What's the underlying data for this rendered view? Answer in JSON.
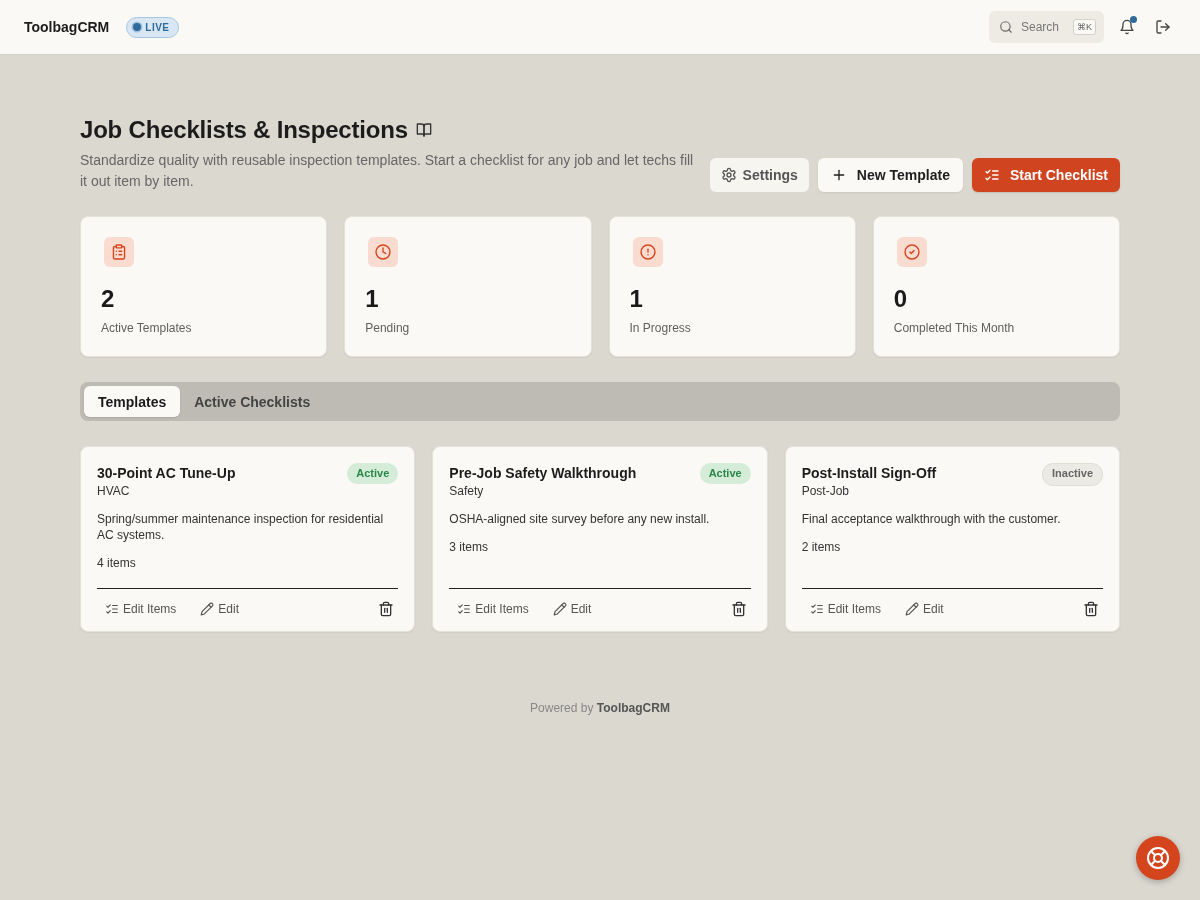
{
  "header": {
    "brand": "ToolbagCRM",
    "badge": "LIVE",
    "search": {
      "label": "Search",
      "shortcut": "⌘K"
    },
    "notifications": {
      "unread": true
    }
  },
  "page": {
    "title": "Job Checklists & Inspections",
    "subtitle": "Standardize quality with reusable inspection templates. Start a checklist for any job and let techs fill it out item by item.",
    "buttons": [
      {
        "kind": "secondary",
        "label": "Settings"
      },
      {
        "kind": "outline",
        "label": "New Template"
      },
      {
        "kind": "primary",
        "label": "Start Checklist"
      }
    ]
  },
  "stats": [
    {
      "value": "2",
      "label": "Active Templates"
    },
    {
      "value": "1",
      "label": "Pending"
    },
    {
      "value": "1",
      "label": "In Progress"
    },
    {
      "value": "0",
      "label": "Completed This Month"
    }
  ],
  "tabs": [
    {
      "label": "Templates",
      "selected": true
    },
    {
      "label": "Active Checklists",
      "selected": false
    }
  ],
  "templates": [
    {
      "title": "30-Point AC Tune-Up",
      "category": "HVAC",
      "status": "Active",
      "active": true,
      "description": "Spring/summer maintenance inspection for residential AC systems.",
      "item_count": "4 items",
      "actions": [
        "Edit Items",
        "Edit"
      ]
    },
    {
      "title": "Pre-Job Safety Walkthrough",
      "category": "Safety",
      "status": "Active",
      "active": true,
      "description": "OSHA-aligned site survey before any new install.",
      "item_count": "3 items",
      "actions": [
        "Edit Items",
        "Edit"
      ]
    },
    {
      "title": "Post-Install Sign-Off",
      "category": "Post-Job",
      "status": "Inactive",
      "active": false,
      "description": "Final acceptance walkthrough with the customer.",
      "item_count": "2 items",
      "actions": [
        "Edit Items",
        "Edit"
      ]
    }
  ],
  "footer": "Powered by **ToolbagCRM**"
}
